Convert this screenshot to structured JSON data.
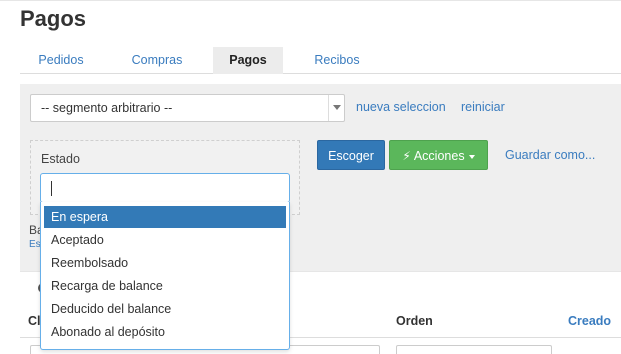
{
  "page": {
    "title": "Pagos"
  },
  "tabs": [
    {
      "label": "Pedidos",
      "active": false
    },
    {
      "label": "Compras",
      "active": false
    },
    {
      "label": "Pagos",
      "active": true
    },
    {
      "label": "Recibos",
      "active": false
    }
  ],
  "filters": {
    "segment_select_value": "-- segmento arbitrario --",
    "new_selection_link": "nueva seleccion",
    "reset_link": "reiniciar",
    "estado_label": "Estado",
    "estado_search_value": "",
    "estado_options": [
      "En espera",
      "Aceptado",
      "Reembolsado",
      "Recarga de balance",
      "Deducido del balance",
      "Abonado al depósito"
    ],
    "highlighted_option_index": 0,
    "partial_label_ba": "Ba",
    "partial_label_es": "Es"
  },
  "actions": {
    "choose_button": "Escoger",
    "actions_button": "Acciones",
    "save_as_link": "Guardar como..."
  },
  "table": {
    "headers": {
      "partial_first": "Cl",
      "order": "Orden",
      "created": "Creado"
    }
  },
  "colors": {
    "primary_blue": "#3379b7",
    "success_green": "#5bb75b",
    "link_blue": "#3a7cbf",
    "panel_bg": "#efefef"
  }
}
